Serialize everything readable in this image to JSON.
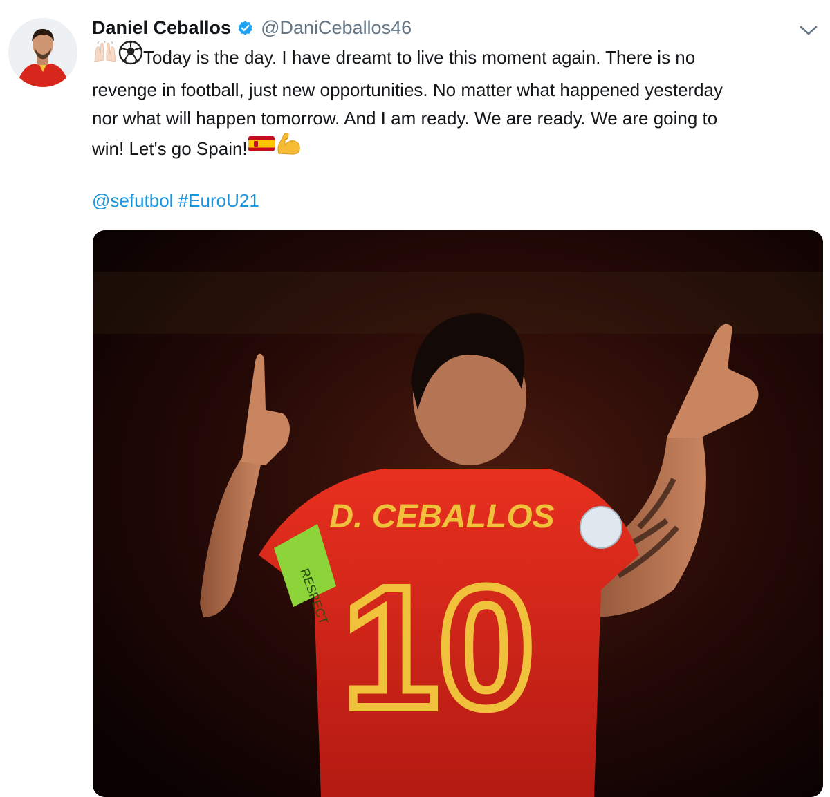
{
  "author": {
    "name": "Daniel Ceballos",
    "handle": "@DaniCeballos46",
    "verified": true,
    "avatar_icon": "profile-photo"
  },
  "tweet": {
    "line1": "Today is the day. I have dreamt to live this moment again. There is no",
    "line2": "revenge in football, just new opportunities. No matter what happened yesterday",
    "line3": "nor what will happen tomorrow. And I am ready. We are ready. We are going to",
    "line4": "win! Let's go Spain!",
    "emojis": [
      "raised-hands",
      "soccer-ball",
      "flag-spain",
      "flexed-biceps"
    ],
    "mention": "@sefutbol",
    "hashtag": "#EuroU21"
  },
  "media": {
    "jersey_name": "D. CEBALLOS",
    "jersey_number": "10",
    "armband_text": "RESPECT"
  },
  "icons": {
    "verified": "verified-badge-icon",
    "menu": "chevron-down-icon"
  },
  "colors": {
    "link": "#1b95e0",
    "verified": "#1da1f2",
    "handle": "#657786",
    "jersey": "#d6241a",
    "jersey_print": "#f0c23c"
  }
}
